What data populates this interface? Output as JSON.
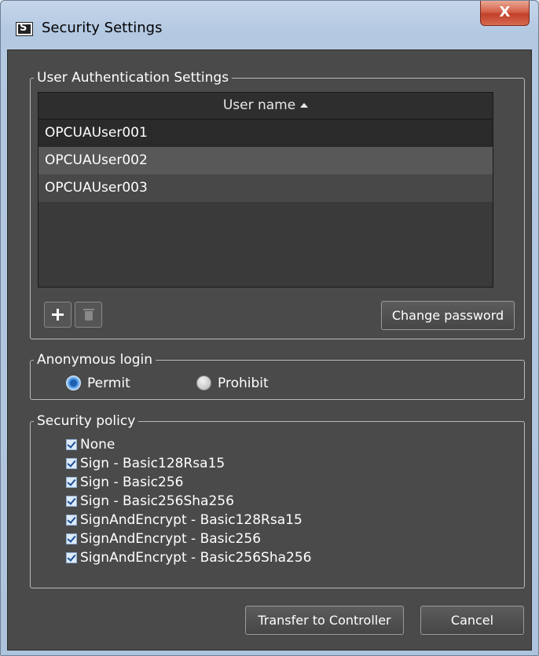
{
  "window": {
    "title": "Security Settings",
    "close_label": "X"
  },
  "user_auth": {
    "group_label": "User Authentication Settings",
    "column_header": "User name",
    "users": [
      "OPCUAUser001",
      "OPCUAUser002",
      "OPCUAUser003"
    ],
    "change_password_label": "Change password"
  },
  "anonymous_login": {
    "group_label": "Anonymous login",
    "options": [
      "Permit",
      "Prohibit"
    ],
    "selected": "Permit"
  },
  "security_policy": {
    "group_label": "Security policy",
    "items": [
      {
        "label": "None",
        "checked": true
      },
      {
        "label": "Sign - Basic128Rsa15",
        "checked": true
      },
      {
        "label": "Sign - Basic256",
        "checked": true
      },
      {
        "label": "Sign - Basic256Sha256",
        "checked": true
      },
      {
        "label": "SignAndEncrypt - Basic128Rsa15",
        "checked": true
      },
      {
        "label": "SignAndEncrypt - Basic256",
        "checked": true
      },
      {
        "label": "SignAndEncrypt - Basic256Sha256",
        "checked": true
      }
    ]
  },
  "buttons": {
    "transfer_label": "Transfer to Controller",
    "cancel_label": "Cancel"
  },
  "colors": {
    "window_frame": "#b3c8e1",
    "client_bg": "#4a4a4a",
    "close_button": "#c1412a",
    "radio_selected": "#3d8ee0"
  },
  "icons": [
    "app-icon",
    "close-icon",
    "sort-ascending-icon",
    "add-icon",
    "trash-icon"
  ]
}
